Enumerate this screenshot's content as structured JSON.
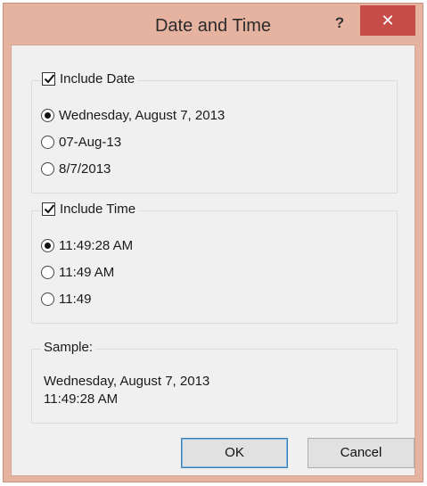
{
  "window": {
    "title": "Date and Time",
    "help_label": "?",
    "close_label": "✕"
  },
  "date_group": {
    "label": "Include Date",
    "checked": true,
    "options": [
      {
        "label": "Wednesday, August 7, 2013",
        "selected": true
      },
      {
        "label": "07-Aug-13",
        "selected": false
      },
      {
        "label": "8/7/2013",
        "selected": false
      }
    ]
  },
  "time_group": {
    "label": "Include Time",
    "checked": true,
    "options": [
      {
        "label": "11:49:28 AM",
        "selected": true
      },
      {
        "label": "11:49 AM",
        "selected": false
      },
      {
        "label": "11:49",
        "selected": false
      }
    ]
  },
  "sample": {
    "label": "Sample:",
    "line1": "Wednesday, August 7, 2013",
    "line2": "11:49:28 AM"
  },
  "buttons": {
    "ok_label": "OK",
    "cancel_label": "Cancel"
  },
  "colors": {
    "titlebar": "#e6b3a1",
    "close_button": "#c74b47",
    "client_bg": "#f0f0f0"
  }
}
